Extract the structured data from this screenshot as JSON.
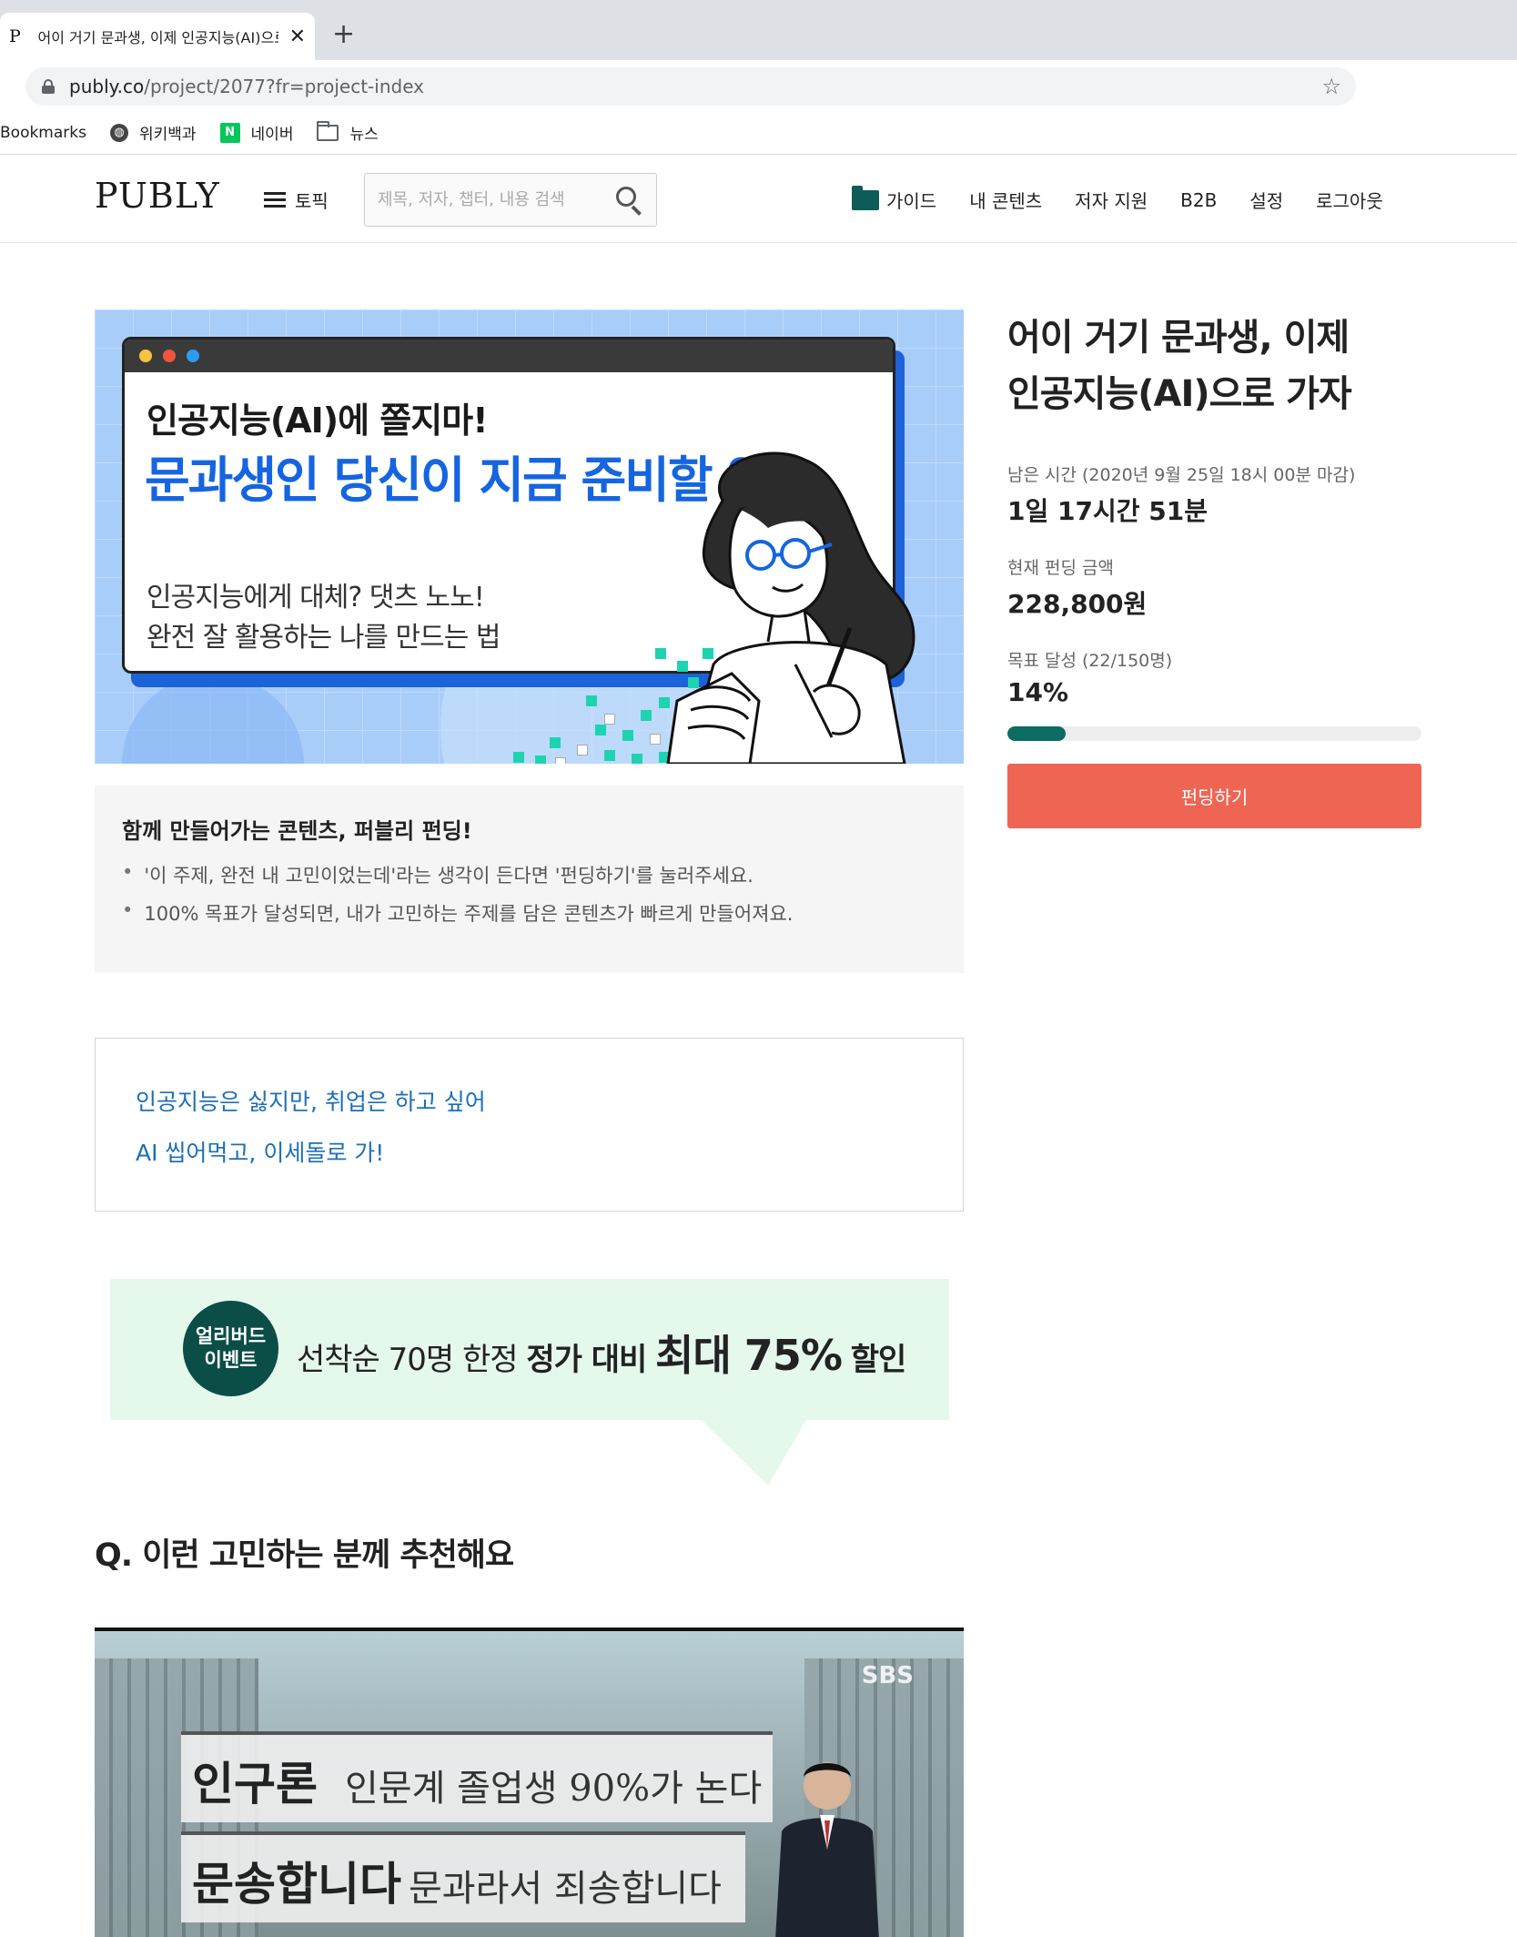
{
  "browser": {
    "tab_favicon": "P",
    "tab_title": "어이 거기 문과생, 이제 인공지능(AI)으로 가자",
    "url_domain": "publy.co",
    "url_path": "/project/2077?fr=project-index",
    "bookmarks": [
      "Bookmarks",
      "위키백과",
      "네이버",
      "뉴스"
    ]
  },
  "header": {
    "logo": "PUBLY",
    "topic_label": "토픽",
    "search_placeholder": "제목, 저자, 챕터, 내용 검색",
    "nav": [
      "가이드",
      "내 콘텐츠",
      "저자 지원",
      "B2B",
      "설정",
      "로그아웃"
    ]
  },
  "banner": {
    "line1": "인공지능(AI)에 쫄지마!",
    "line2": "문과생인 당신이 지금 준비할 일",
    "line3": "인공지능에게 대체? 댓츠 노노!",
    "line4": "완전 잘 활용하는 나를 만드는 법"
  },
  "info": {
    "title": "함께 만들어가는 콘텐츠, 퍼블리 펀딩!",
    "bullets": [
      "'이 주제, 완전 내 고민이었는데'라는 생각이 든다면 '펀딩하기'를 눌러주세요.",
      "100% 목표가 달성되면, 내가 고민하는 주제를 담은 콘텐츠가 빠르게 만들어져요."
    ]
  },
  "subtitle": {
    "line1": "인공지능은 싫지만, 취업은 하고 싶어",
    "line2": "AI 씹어먹고, 이세돌로 가!"
  },
  "earlybird": {
    "badge_line1": "얼리버드",
    "badge_line2": "이벤트",
    "text_normal": "선착순 70명 한정",
    "text_bold": "정가 대비",
    "text_big": "최대 75%",
    "text_end": "할인"
  },
  "section_heading": "Q. 이런 고민하는 분께 추천해요",
  "video": {
    "channel": "SBS",
    "caption1_main": "인구론",
    "caption1_sub": "인문계 졸업생 90%가 논다",
    "caption2_main": "문송합니다",
    "caption2_sub": "문과라서 죄송합니다"
  },
  "sidebar": {
    "title_line1": "어이 거기 문과생, 이제",
    "title_line2": "인공지능(AI)으로 가자",
    "remaining_label": "남은 시간  (2020년 9월 25일 18시 00분 마감)",
    "remaining_value": "1일 17시간 51분",
    "amount_label": "현재 펀딩 금액",
    "amount_value": "228,800원",
    "goal_label": "목표 달성  (22/150명)",
    "goal_value": "14%",
    "progress_fraction": 0.14,
    "fund_button": "펀딩하기"
  },
  "colors": {
    "accent_green": "#0b6d62",
    "fund_button": "#ee6554",
    "link_blue": "#1d6fb8",
    "banner_blue": "#1565e0"
  }
}
